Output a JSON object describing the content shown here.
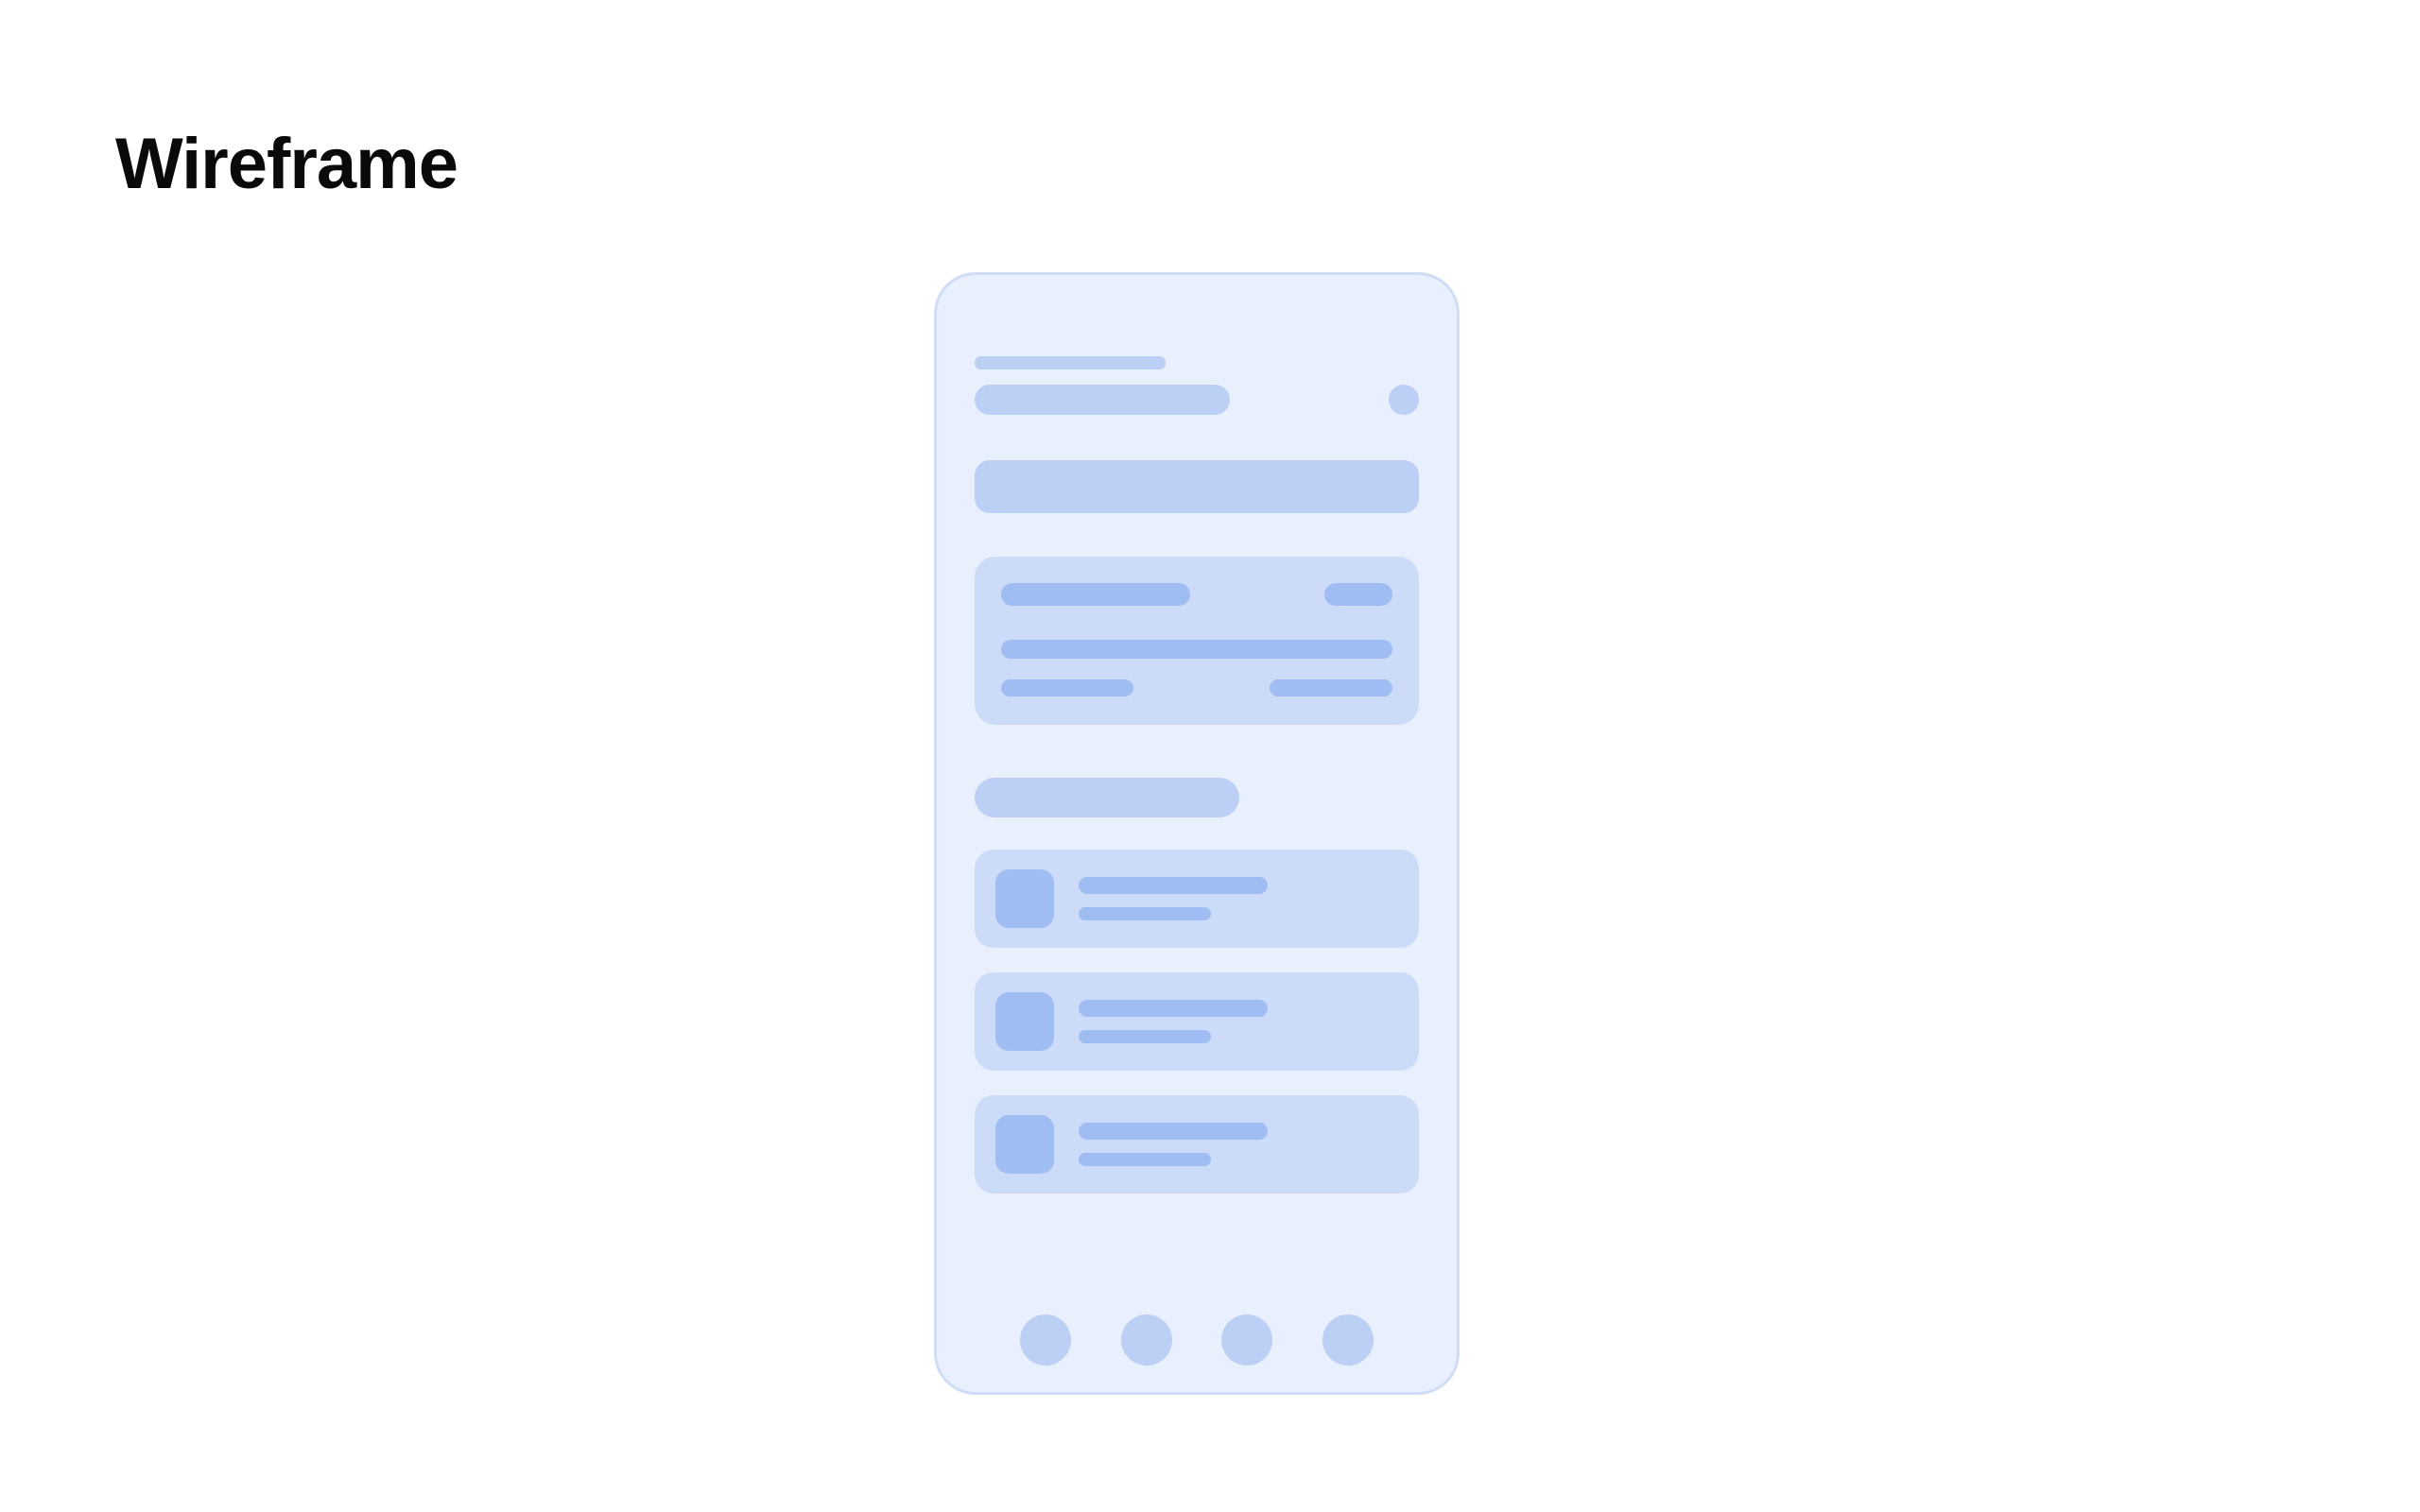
{
  "page_title": "Wireframe",
  "colors": {
    "frame_bg": "#e8effd",
    "frame_border": "#d0ddf6",
    "placeholder_light": "#bccff5",
    "card_bg": "#ccdcf8",
    "placeholder_dark": "#9fbdf2"
  },
  "device": {
    "header": {
      "subtitle": "",
      "title": "",
      "avatar": "avatar-icon"
    },
    "search": {
      "placeholder": ""
    },
    "feature_card": {
      "title": "",
      "badge": "",
      "line1": "",
      "meta_left": "",
      "meta_right": ""
    },
    "section_header": "",
    "list": [
      {
        "thumb": "thumb-icon",
        "title": "",
        "subtitle": ""
      },
      {
        "thumb": "thumb-icon",
        "title": "",
        "subtitle": ""
      },
      {
        "thumb": "thumb-icon",
        "title": "",
        "subtitle": ""
      }
    ],
    "bottom_nav": [
      {
        "icon": "nav-icon-1"
      },
      {
        "icon": "nav-icon-2"
      },
      {
        "icon": "nav-icon-3"
      },
      {
        "icon": "nav-icon-4"
      }
    ]
  }
}
